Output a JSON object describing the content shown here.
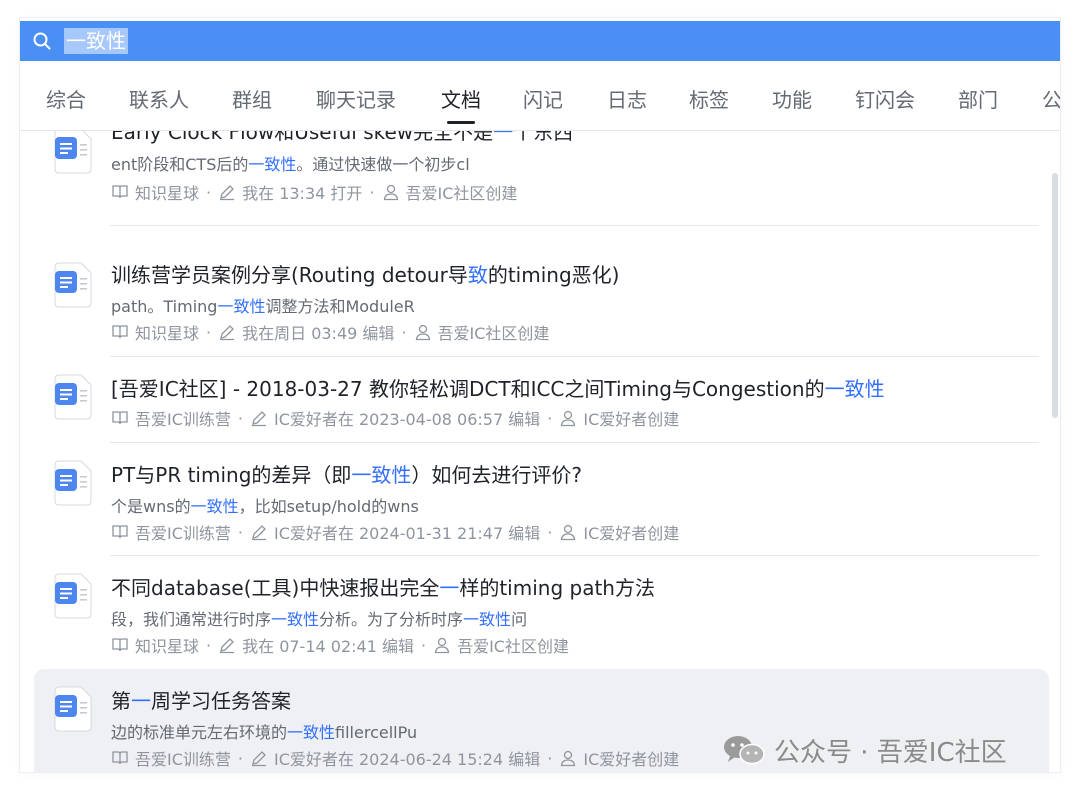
{
  "search": {
    "query": "一致性"
  },
  "tabs": [
    {
      "label": "综合"
    },
    {
      "label": "联系人"
    },
    {
      "label": "群组"
    },
    {
      "label": "聊天记录"
    },
    {
      "label": "文档"
    },
    {
      "label": "闪记"
    },
    {
      "label": "日志"
    },
    {
      "label": "标签"
    },
    {
      "label": "功能"
    },
    {
      "label": "钉闪会"
    },
    {
      "label": "部门"
    },
    {
      "label": "公"
    }
  ],
  "active_tab": "文档",
  "results": [
    {
      "title": [
        "Early Clock Flow和Useful skew完全不是",
        "一",
        "个东西"
      ],
      "snippet": [
        "ent阶段和CTS后的",
        "一致性",
        "。通过快速做一个初步cl"
      ],
      "source": "知识星球",
      "activity": "我在 13:34 打开",
      "creator": "吾爱IC社区创建"
    },
    {
      "title": [
        "训练营学员案例分享(Routing detour导",
        "致",
        "的timing恶化)"
      ],
      "snippet": [
        "path。Timing",
        "一致性",
        "调整方法和ModuleR"
      ],
      "source": "知识星球",
      "activity": "我在周日 03:49 编辑",
      "creator": "吾爱IC社区创建"
    },
    {
      "title": [
        "[吾爱IC社区] - 2018-03-27 教你轻松调DCT和ICC之间Timing与Congestion的",
        "一致性",
        ""
      ],
      "source": "吾爱IC训练营",
      "activity": "IC爱好者在 2023-04-08 06:57 编辑",
      "creator": "IC爱好者创建"
    },
    {
      "title": [
        "PT与PR timing的差异（即",
        "一致性",
        "）如何去进行评价?"
      ],
      "snippet": [
        "个是wns的",
        "一致性",
        "，比如setup/hold的wns"
      ],
      "source": "吾爱IC训练营",
      "activity": "IC爱好者在 2024-01-31 21:47 编辑",
      "creator": "IC爱好者创建"
    },
    {
      "title": [
        "不同database(工具)中快速报出完全",
        "一",
        "样的timing path方法"
      ],
      "snippet": [
        "段，我们通常进行时序",
        "一致性",
        "分析。为了分析时序",
        "一致性",
        "问"
      ],
      "source": "知识星球",
      "activity": "我在 07-14 02:41 编辑",
      "creator": "吾爱IC社区创建"
    },
    {
      "title": [
        "第",
        "一",
        "周学习任务答案"
      ],
      "snippet": [
        "边的标准单元左右环境的",
        "一致性",
        "fillercellPu"
      ],
      "source": "吾爱IC训练营",
      "activity": "IC爱好者在 2024-06-24 15:24 编辑",
      "creator": "IC爱好者创建"
    }
  ],
  "watermark": {
    "text": "公众号 · 吾爱IC社区"
  },
  "colors": {
    "search_bar": "#4a8ff3",
    "highlight": "#3370ff",
    "doc_icon": "#4e86f0"
  },
  "icons": {
    "search": "search-icon",
    "document": "doc-icon",
    "source": "book-icon",
    "activity": "pencil-icon",
    "creator": "person-icon",
    "watermark": "wechat-icon"
  }
}
